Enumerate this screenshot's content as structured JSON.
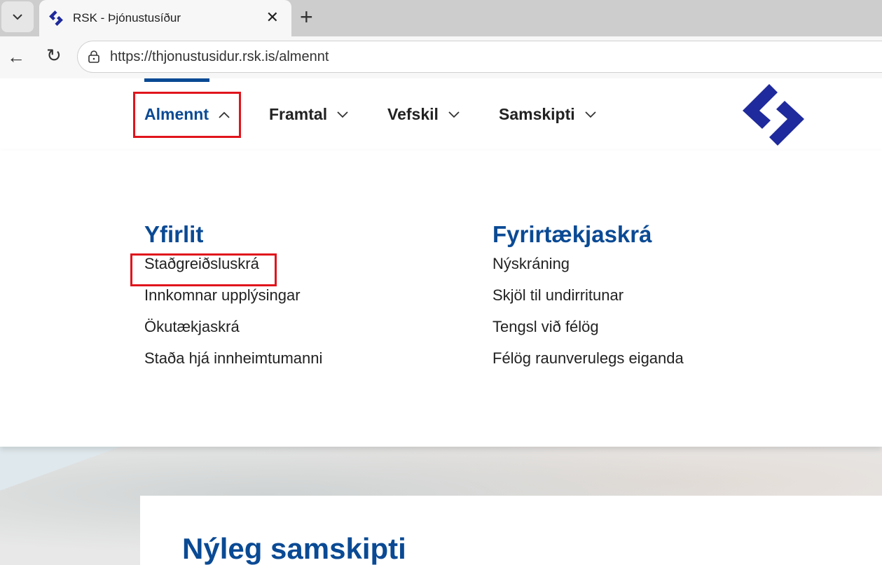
{
  "browser": {
    "tab_title": "RSK - Þjónustusíður",
    "url": "https://thjonustusidur.rsk.is/almennt"
  },
  "nav": {
    "items": [
      {
        "label": "Almennt",
        "expanded": true
      },
      {
        "label": "Framtal"
      },
      {
        "label": "Vefskil"
      },
      {
        "label": "Samskipti"
      }
    ]
  },
  "menu": {
    "col1": {
      "heading": "Yfirlit",
      "links": [
        "Staðgreiðsluskrá",
        "Innkomnar upplýsingar",
        "Ökutækjaskrá",
        "Staða hjá innheimtumanni"
      ]
    },
    "col2": {
      "heading": "Fyrirtækjaskrá",
      "links": [
        "Nýskráning",
        "Skjöl til undirritunar",
        "Tengsl við félög",
        "Félög raunverulegs eiganda"
      ]
    }
  },
  "main": {
    "heading": "Nýleg samskipti"
  },
  "colors": {
    "brand": "#0a4a94",
    "logo": "#1f2a9c",
    "highlight": "#e0141c"
  }
}
